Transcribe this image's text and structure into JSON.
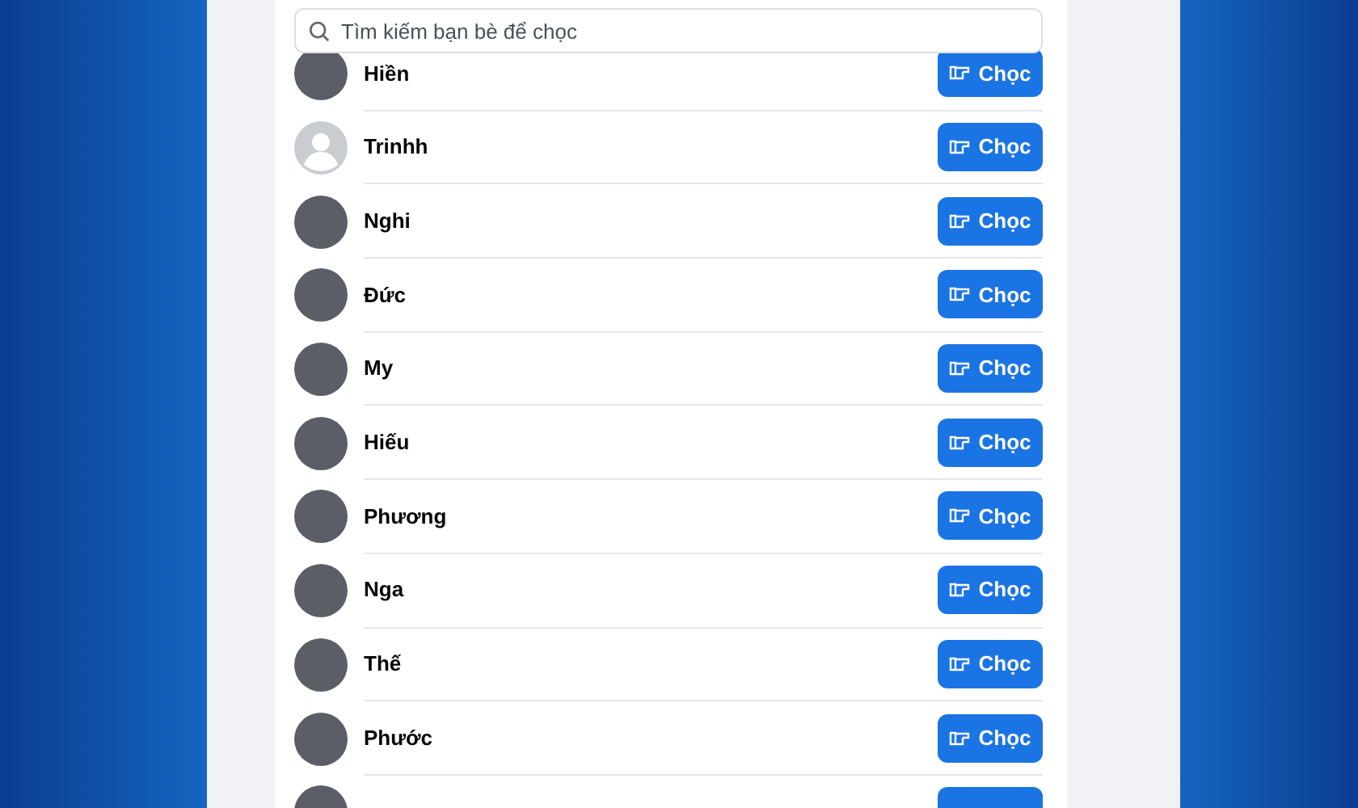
{
  "search": {
    "placeholder": "Tìm kiếm bạn bè để chọc"
  },
  "friends": [
    {
      "name": "Hiền",
      "kind": "photo",
      "button": "Chọc"
    },
    {
      "name": "Trinhh",
      "kind": "default",
      "button": "Chọc"
    },
    {
      "name": "Nghi",
      "kind": "photo",
      "button": "Chọc"
    },
    {
      "name": "Đức",
      "kind": "photo",
      "button": "Chọc"
    },
    {
      "name": "My",
      "kind": "photo",
      "button": "Chọc"
    },
    {
      "name": "Hiếu",
      "kind": "photo",
      "button": "Chọc"
    },
    {
      "name": "Phương",
      "kind": "photo",
      "button": "Chọc"
    },
    {
      "name": "Nga",
      "kind": "photo",
      "button": "Chọc"
    },
    {
      "name": "Thế",
      "kind": "photo",
      "button": "Chọc"
    },
    {
      "name": "Phước",
      "kind": "photo",
      "button": "Chọc"
    },
    {
      "kind": "photo"
    }
  ]
}
